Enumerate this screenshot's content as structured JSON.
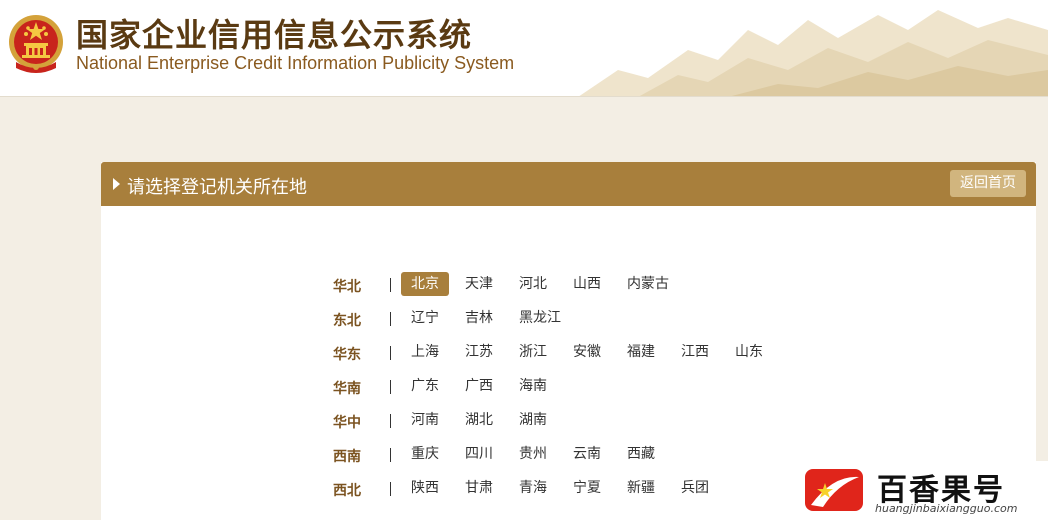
{
  "header": {
    "title_cn": "国家企业信用信息公示系统",
    "title_en": "National Enterprise Credit Information Publicity System"
  },
  "panel": {
    "title": "请选择登记机关所在地",
    "home_button": "返回首页"
  },
  "regions": [
    {
      "name": "华北",
      "provinces": [
        "北京",
        "天津",
        "河北",
        "山西",
        "内蒙古"
      ],
      "selected": "北京"
    },
    {
      "name": "东北",
      "provinces": [
        "辽宁",
        "吉林",
        "黑龙江"
      ]
    },
    {
      "name": "华东",
      "provinces": [
        "上海",
        "江苏",
        "浙江",
        "安徽",
        "福建",
        "江西",
        "山东"
      ]
    },
    {
      "name": "华南",
      "provinces": [
        "广东",
        "广西",
        "海南"
      ]
    },
    {
      "name": "华中",
      "provinces": [
        "河南",
        "湖北",
        "湖南"
      ]
    },
    {
      "name": "西南",
      "provinces": [
        "重庆",
        "四川",
        "贵州",
        "云南",
        "西藏"
      ]
    },
    {
      "name": "西北",
      "provinces": [
        "陕西",
        "甘肃",
        "青海",
        "宁夏",
        "新疆",
        "兵团"
      ]
    }
  ],
  "watermark": {
    "text": "百香果号",
    "url": "huangjinbaixiangguo.com"
  },
  "colors": {
    "accent": "#a87f3c",
    "button": "#d1b57e",
    "background": "#f3eee4",
    "region_label": "#7b5320"
  },
  "icons": {
    "emblem": "national-emblem-icon",
    "panel_arrow": "caret-right-icon",
    "watermark_logo": "star-flag-logo-icon"
  }
}
